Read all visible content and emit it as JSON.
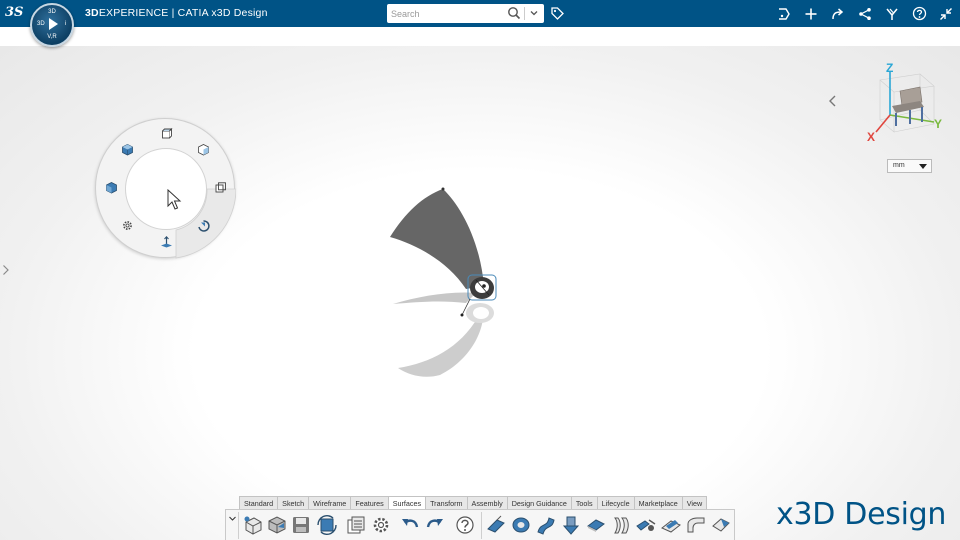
{
  "topbar": {
    "brand_bold": "3D",
    "brand_rest": "EXPERIENCE | CATIA  x3D Design",
    "compass_top": "3D",
    "compass_left": "3D",
    "compass_right": "i",
    "compass_bottom": "V,R",
    "search_placeholder": "Search",
    "icons": [
      "share-icon",
      "plus-icon",
      "forward-icon",
      "network-icon",
      "tools-icon",
      "help-icon",
      "collapse-icon"
    ]
  },
  "viewport": {
    "units_value": "mm",
    "axis_labels": {
      "z": "Z",
      "x": "X",
      "y": "Y"
    }
  },
  "action_bar": {
    "tabs": [
      "Standard",
      "Sketch",
      "Wireframe",
      "Features",
      "Surfaces",
      "Transform",
      "Assembly",
      "Design Guidance",
      "Tools",
      "Lifecycle",
      "Marketplace",
      "View"
    ],
    "active_tab": "Surfaces",
    "commands": [
      "new-part-icon",
      "open-icon",
      "save-icon",
      "update-icon",
      "properties-icon",
      "settings-icon",
      "undo-icon",
      "redo-icon",
      "help-icon",
      "sweep-icon",
      "revolve-icon",
      "multi-section-icon",
      "extrude-icon",
      "fill-icon",
      "offset-icon",
      "join-icon",
      "split-icon",
      "blend-icon",
      "trim-icon"
    ]
  },
  "watermark": "x3D Design"
}
